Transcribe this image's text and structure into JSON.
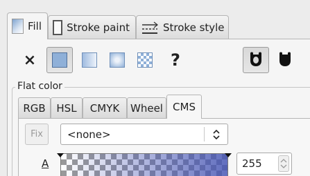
{
  "tabs": [
    {
      "label": "Fill",
      "icon": "fill-swatch-icon",
      "active": true
    },
    {
      "label": "Stroke paint",
      "icon": "stroke-swatch-icon",
      "active": false
    },
    {
      "label": "Stroke style",
      "icon": "stroke-style-icon",
      "active": false
    }
  ],
  "paint_types": {
    "no_paint_glyph": "×",
    "unset_glyph": "?",
    "buttons": [
      "no-paint",
      "flat-color",
      "linear-gradient",
      "radial-gradient",
      "pattern",
      "unset"
    ]
  },
  "flat_color": {
    "label": "Flat color",
    "modes": [
      "RGB",
      "HSL",
      "CMYK",
      "Wheel",
      "CMS"
    ],
    "active_mode": "CMS",
    "fix_label": "Fix",
    "profile_value": "<none>",
    "alpha_label": "A",
    "alpha_value": "255"
  },
  "colors": {
    "accent": "#4655b4",
    "swatch_blue": "#7ea3cf"
  }
}
